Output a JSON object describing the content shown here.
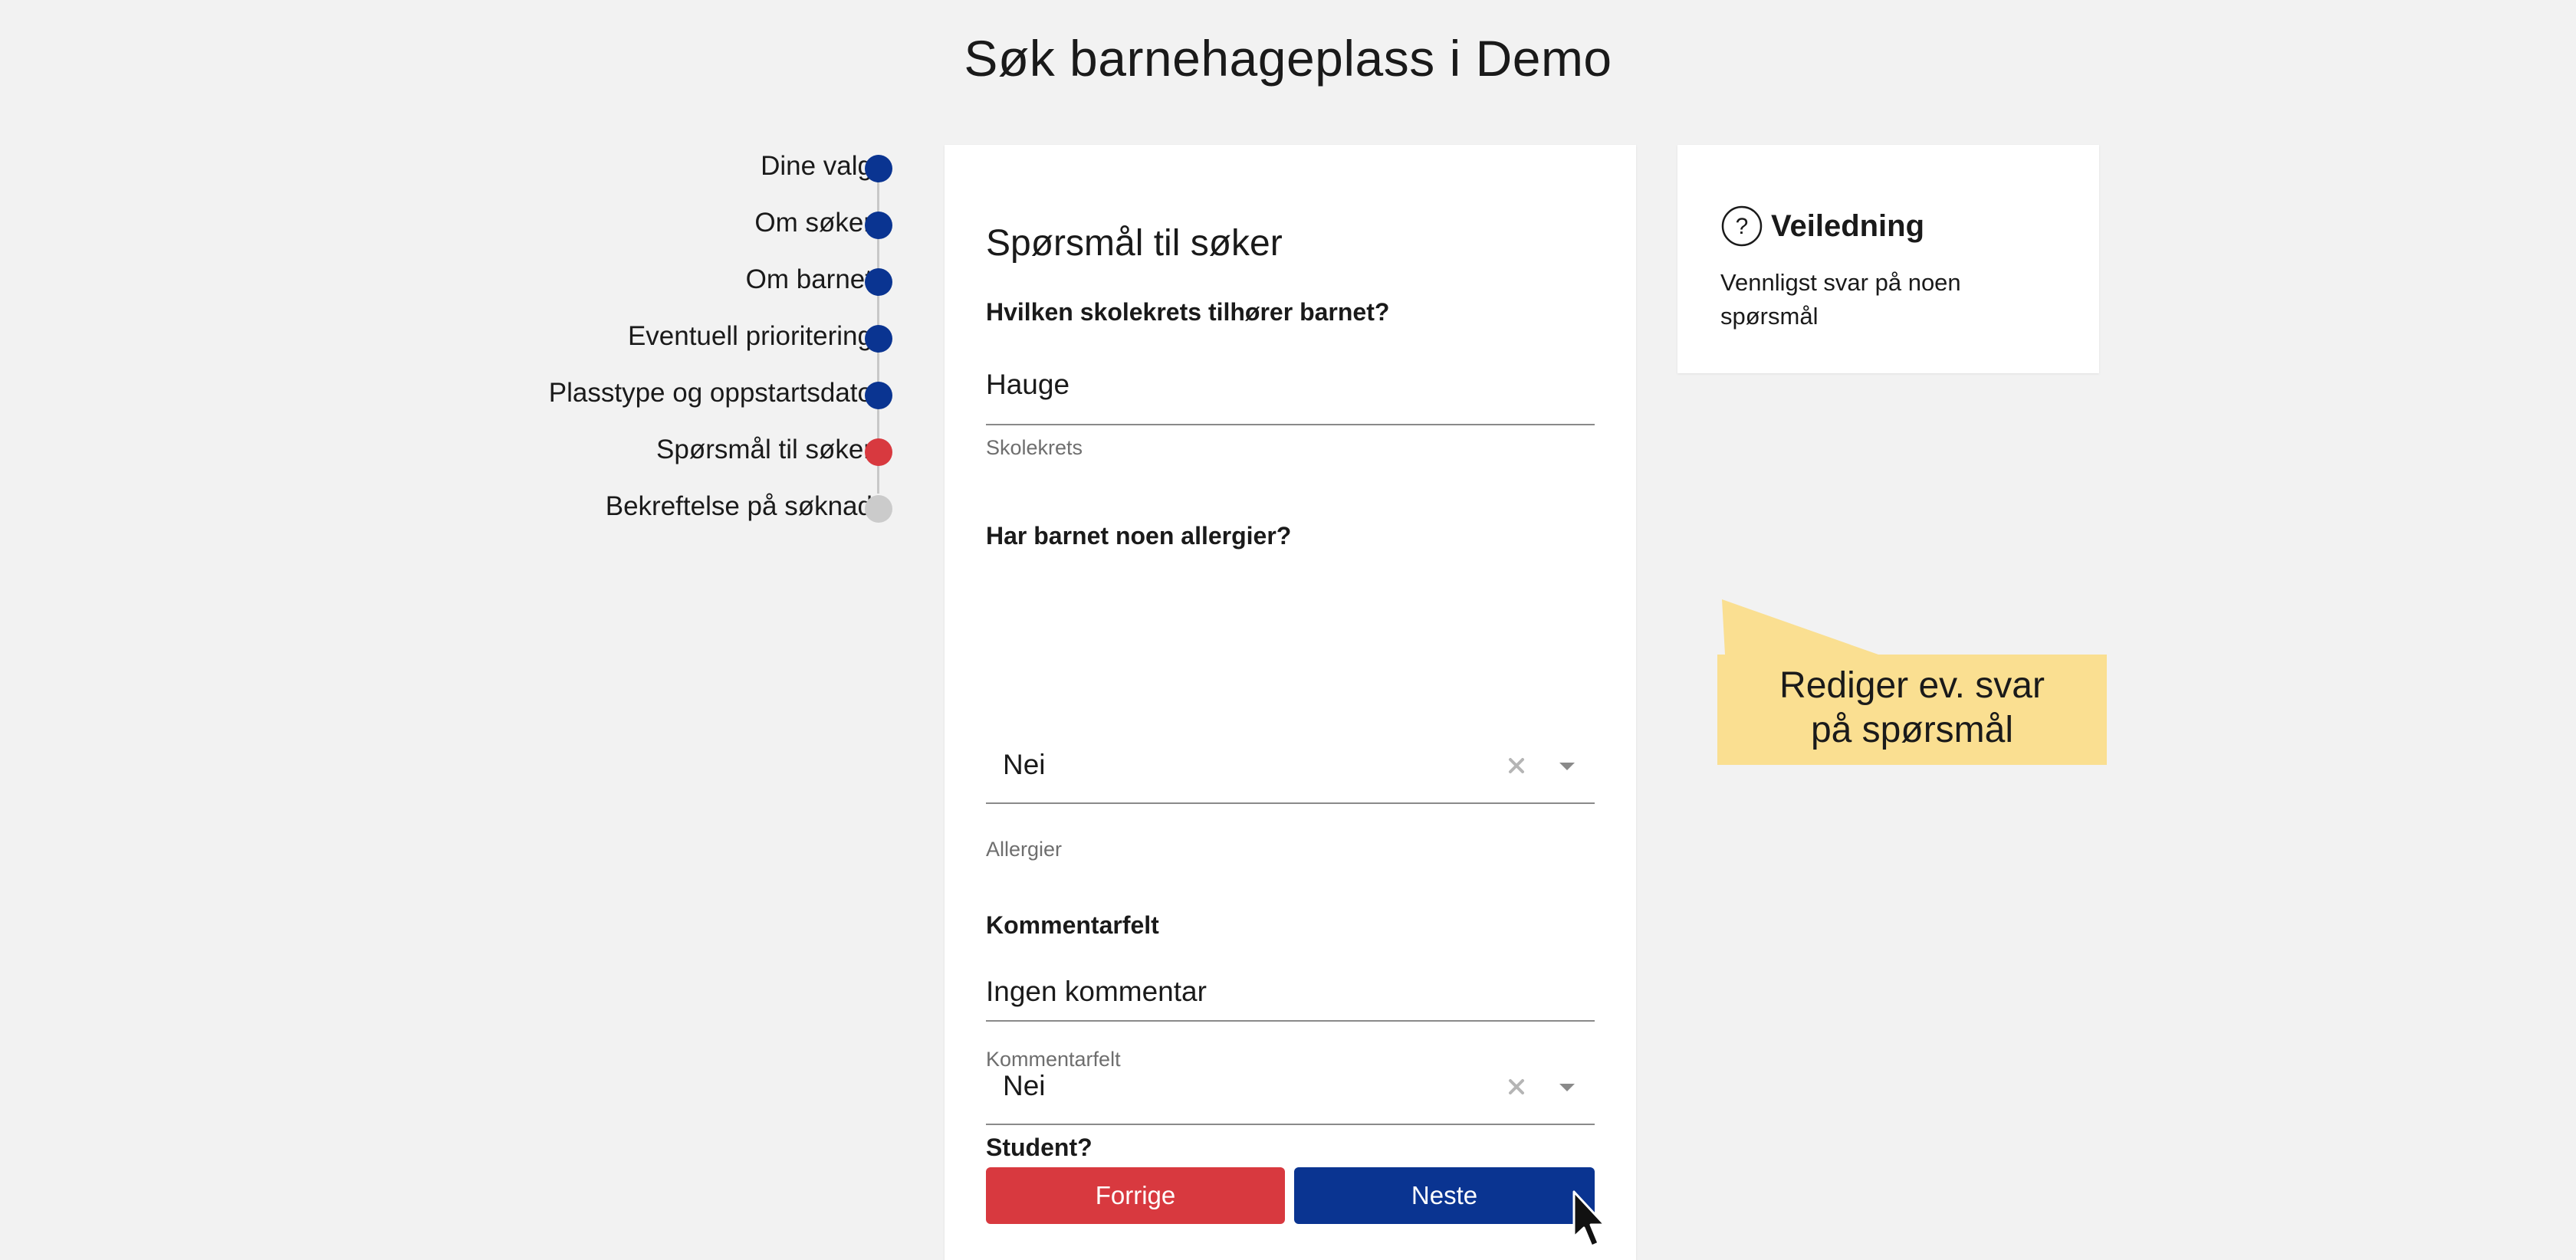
{
  "page": {
    "title": "Søk barnehageplass i Demo"
  },
  "stepper": {
    "steps": [
      {
        "label": "Dine valg",
        "state": "done"
      },
      {
        "label": "Om søker",
        "state": "done"
      },
      {
        "label": "Om barnet",
        "state": "done"
      },
      {
        "label": "Eventuell prioritering",
        "state": "done"
      },
      {
        "label": "Plasstype og oppstartsdato",
        "state": "done"
      },
      {
        "label": "Spørsmål til søker",
        "state": "current"
      },
      {
        "label": "Bekreftelse på søknad",
        "state": "pending"
      }
    ]
  },
  "form": {
    "heading": "Spørsmål til søker",
    "school": {
      "question": "Hvilken skolekrets tilhører barnet?",
      "value": "Hauge",
      "helper": "Skolekrets"
    },
    "allergies": {
      "question": "Har barnet noen allergier?",
      "value": "Nei",
      "helper": "Allergier"
    },
    "comment": {
      "question": "Kommentarfelt",
      "value": "Ingen kommentar",
      "helper": "Kommentarfelt"
    },
    "student": {
      "question": "Student?",
      "value": "Nei"
    },
    "buttons": {
      "prev": "Forrige",
      "next": "Neste"
    }
  },
  "guide": {
    "title": "Veiledning",
    "text": "Vennligst svar på noen spørsmål"
  },
  "callout": {
    "line1": "Rediger ev. svar",
    "line2": "på spørsmål"
  },
  "colors": {
    "done": "#0a3491",
    "current": "#d8393f",
    "pending": "#cbcbcb",
    "primary": "#0a3491",
    "danger": "#d8393f",
    "callout": "#fadf91"
  }
}
